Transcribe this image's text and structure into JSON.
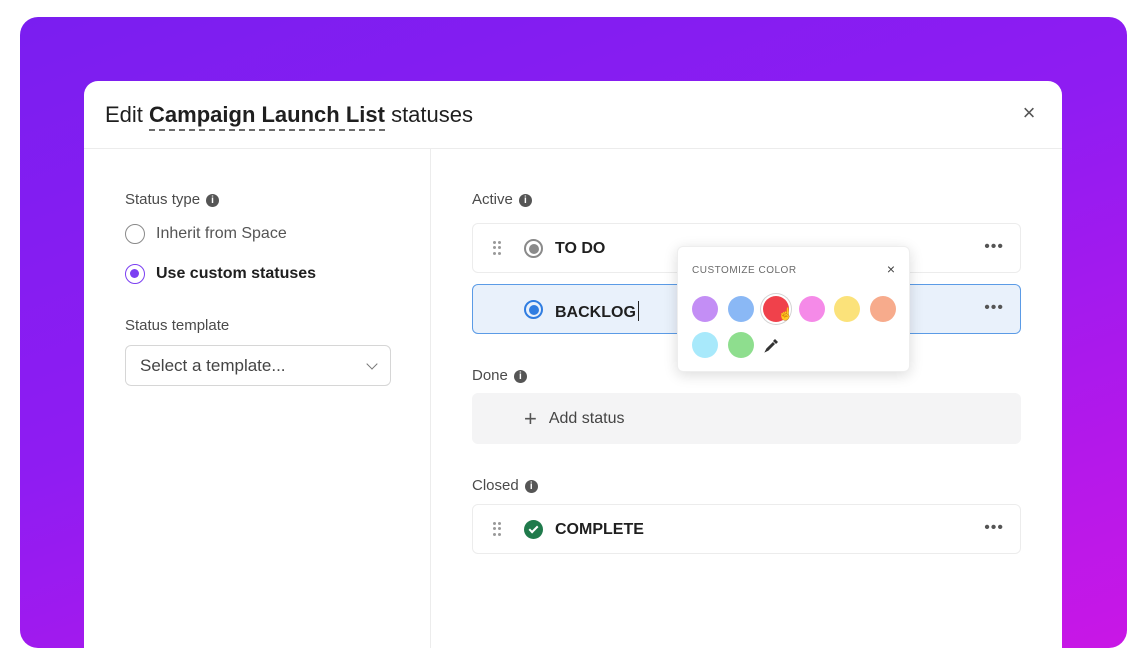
{
  "modal": {
    "title_prefix": "Edit ",
    "list_name": "Campaign Launch List",
    "title_suffix": " statuses",
    "close_glyph": "×"
  },
  "left": {
    "status_type_label": "Status type",
    "options": [
      {
        "label": "Inherit from Space",
        "checked": false
      },
      {
        "label": "Use custom statuses",
        "checked": true
      }
    ],
    "template_label": "Status template",
    "template_placeholder": "Select a template..."
  },
  "groups": {
    "active_label": "Active",
    "done_label": "Done",
    "closed_label": "Closed",
    "add_status_label": "Add status"
  },
  "statuses": [
    {
      "name": "TO DO",
      "color": "#8a8a8a",
      "group": "Active"
    },
    {
      "name": "BACKLOG",
      "color": "#2f7de1",
      "group": "Active",
      "editing": true
    },
    {
      "name": "COMPLETE",
      "color": "#1f7a4b",
      "group": "Closed"
    }
  ],
  "color_picker": {
    "title": "CUSTOMIZE COLOR",
    "close_glyph": "×",
    "swatches": [
      "#c38ef5",
      "#8ab8f5",
      "#f0414b",
      "#f58ae8",
      "#fbe27a",
      "#f7ab8c",
      "#a8e9fb",
      "#8ede8e"
    ],
    "selected": "#f0414b"
  },
  "icons": {
    "info": "info-icon",
    "drag": "drag-handle-icon",
    "more": "more-icon",
    "plus": "plus-icon",
    "chevron": "chevron-down-icon",
    "eyedropper": "eyedropper-icon"
  }
}
